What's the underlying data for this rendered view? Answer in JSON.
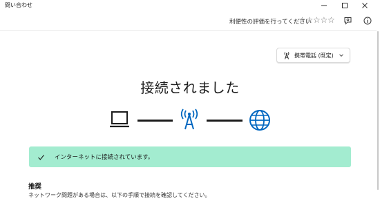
{
  "window": {
    "title": "問い合わせ",
    "controls": {
      "minimize_icon": "minimize-icon",
      "maximize_icon": "maximize-icon",
      "close_icon": "close-icon"
    }
  },
  "header": {
    "rate_label": "利便性の評価を行ってください",
    "stars": [
      "☆",
      "☆",
      "☆",
      "☆",
      "☆"
    ],
    "feedback_icon": "feedback-icon",
    "info_icon": "info-icon"
  },
  "connection_select": {
    "icon": "cellular-antenna-icon",
    "label": "携帯電話 (既定)"
  },
  "status": {
    "heading": "接続されました"
  },
  "diagram": {
    "left_icon": "laptop-icon",
    "middle_icon": "cell-tower-icon",
    "right_icon": "globe-icon",
    "accent_color": "#0067c0"
  },
  "banner": {
    "message": "インターネットに接続されています。",
    "color": "#a3ecd0"
  },
  "recommendation": {
    "title": "推奨",
    "text": "ネットワーク問題がある場合は、以下の手順で接続を確認してください。"
  }
}
